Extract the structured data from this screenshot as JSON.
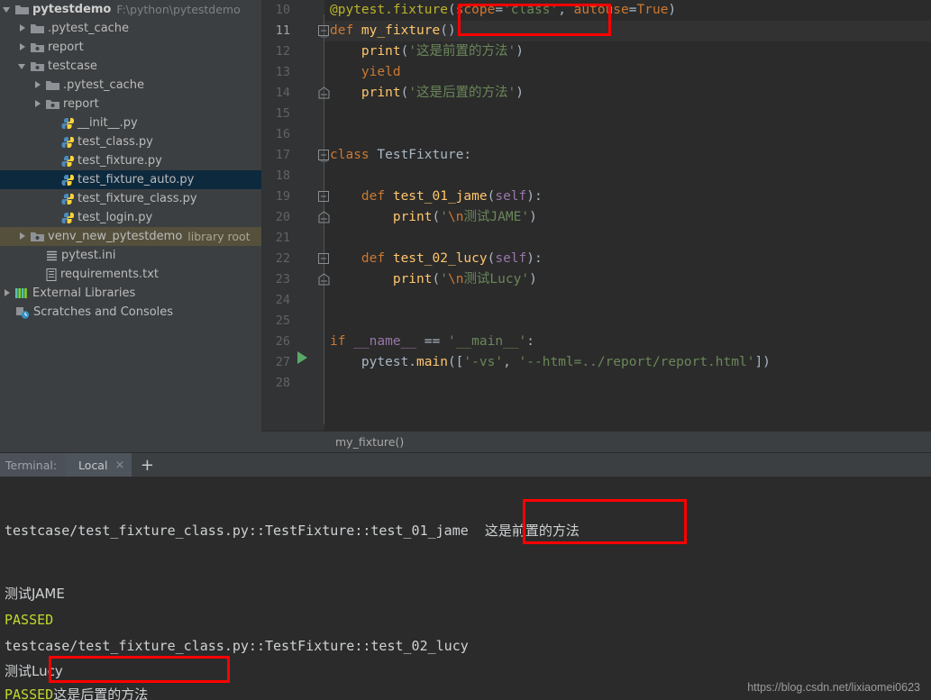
{
  "project_tree": {
    "rows": [
      {
        "indent": 0,
        "arrow": "down",
        "icon": "folder-icon",
        "label": "pytestdemo",
        "bold": true,
        "sub": "F:\\python\\pytestdemo",
        "state": "normal"
      },
      {
        "indent": 1,
        "arrow": "right",
        "icon": "folder-icon",
        "label": ".pytest_cache",
        "bold": false,
        "sub": "",
        "state": "normal"
      },
      {
        "indent": 1,
        "arrow": "right",
        "icon": "folder-excluded-icon",
        "label": "report",
        "bold": false,
        "sub": "",
        "state": "normal"
      },
      {
        "indent": 1,
        "arrow": "down",
        "icon": "folder-source-icon",
        "label": "testcase",
        "bold": false,
        "sub": "",
        "state": "normal"
      },
      {
        "indent": 2,
        "arrow": "right",
        "icon": "folder-icon",
        "label": ".pytest_cache",
        "bold": false,
        "sub": "",
        "state": "normal"
      },
      {
        "indent": 2,
        "arrow": "right",
        "icon": "folder-excluded-icon",
        "label": "report",
        "bold": false,
        "sub": "",
        "state": "normal"
      },
      {
        "indent": 3,
        "arrow": "none",
        "icon": "python-file-icon",
        "label": "__init__.py",
        "bold": false,
        "sub": "",
        "state": "normal"
      },
      {
        "indent": 3,
        "arrow": "none",
        "icon": "python-file-icon",
        "label": "test_class.py",
        "bold": false,
        "sub": "",
        "state": "normal"
      },
      {
        "indent": 3,
        "arrow": "none",
        "icon": "python-file-icon",
        "label": "test_fixture.py",
        "bold": false,
        "sub": "",
        "state": "normal"
      },
      {
        "indent": 3,
        "arrow": "none",
        "icon": "python-file-icon",
        "label": "test_fixture_auto.py",
        "bold": false,
        "sub": "",
        "state": "selected"
      },
      {
        "indent": 3,
        "arrow": "none",
        "icon": "python-file-icon",
        "label": "test_fixture_class.py",
        "bold": false,
        "sub": "",
        "state": "normal"
      },
      {
        "indent": 3,
        "arrow": "none",
        "icon": "python-file-icon",
        "label": "test_login.py",
        "bold": false,
        "sub": "",
        "state": "normal"
      },
      {
        "indent": 1,
        "arrow": "right",
        "icon": "folder-excluded-icon",
        "label": "venv_new_pytestdemo",
        "bold": false,
        "sub": "library root",
        "state": "library"
      },
      {
        "indent": 2,
        "arrow": "none",
        "icon": "ini-file-icon",
        "label": "pytest.ini",
        "bold": false,
        "sub": "",
        "state": "normal"
      },
      {
        "indent": 2,
        "arrow": "none",
        "icon": "text-file-icon",
        "label": "requirements.txt",
        "bold": false,
        "sub": "",
        "state": "normal"
      },
      {
        "indent": 0,
        "arrow": "right",
        "icon": "external-libraries-icon",
        "label": "External Libraries",
        "bold": false,
        "sub": "",
        "state": "normal"
      },
      {
        "indent": 0,
        "arrow": "none",
        "icon": "scratches-icon",
        "label": "Scratches and Consoles",
        "bold": false,
        "sub": "",
        "state": "normal"
      }
    ]
  },
  "editor": {
    "first_line_number": 10,
    "current_line": 11,
    "line_numbers": [
      10,
      11,
      12,
      13,
      14,
      15,
      16,
      17,
      18,
      19,
      20,
      21,
      22,
      23,
      24,
      25,
      26,
      27,
      28
    ],
    "lines": [
      {
        "num": 10,
        "text": "@pytest.fixture(scope='class', autouse=True)"
      },
      {
        "num": 11,
        "text": "def my_fixture():"
      },
      {
        "num": 12,
        "text": "    print('这是前置的方法')"
      },
      {
        "num": 13,
        "text": "    yield"
      },
      {
        "num": 14,
        "text": "    print('这是后置的方法')"
      },
      {
        "num": 15,
        "text": ""
      },
      {
        "num": 16,
        "text": ""
      },
      {
        "num": 17,
        "text": "class TestFixture:"
      },
      {
        "num": 18,
        "text": ""
      },
      {
        "num": 19,
        "text": "    def test_01_jame(self):"
      },
      {
        "num": 20,
        "text": "        print('\\n测试JAME')"
      },
      {
        "num": 21,
        "text": ""
      },
      {
        "num": 22,
        "text": "    def test_02_lucy(self):"
      },
      {
        "num": 23,
        "text": "        print('\\n测试Lucy')"
      },
      {
        "num": 24,
        "text": ""
      },
      {
        "num": 25,
        "text": ""
      },
      {
        "num": 26,
        "text": "if __name__ == '__main__':"
      },
      {
        "num": 27,
        "text": "    pytest.main(['-vs', '--html=../report/report.html'])"
      },
      {
        "num": 28,
        "text": ""
      }
    ],
    "breadcrumb": "my_fixture()"
  },
  "terminal": {
    "label": "Terminal:",
    "tab_name": "Local",
    "close_glyph": "×",
    "add_glyph": "+",
    "output_lines": [
      {
        "kind": "plain",
        "text": "testcase/test_fixture_class.py::TestFixture::test_01_jame "
      },
      {
        "kind": "annotated",
        "text": "这是前置的方法"
      },
      {
        "kind": "blank",
        "text": ""
      },
      {
        "kind": "plain",
        "text": "测试JAME"
      },
      {
        "kind": "passed",
        "text": "PASSED"
      },
      {
        "kind": "plain",
        "text": "testcase/test_fixture_class.py::TestFixture::test_02_lucy"
      },
      {
        "kind": "plain",
        "text": "测试Lucy"
      },
      {
        "kind": "passed_annotated",
        "passed": "PASSED",
        "text": "这是后置的方法"
      }
    ]
  },
  "annotations": {
    "box1_label": "code-highlight-scope-class",
    "box2_label": "output-highlight-setup",
    "box3_label": "output-highlight-teardown"
  },
  "watermark": "https://blog.csdn.net/lixiaomei0623",
  "colors": {
    "accent_red": "#ff0000",
    "passed_green": "#c3d82c",
    "selection_blue": "#0d293e",
    "library_olive": "#55503c"
  }
}
